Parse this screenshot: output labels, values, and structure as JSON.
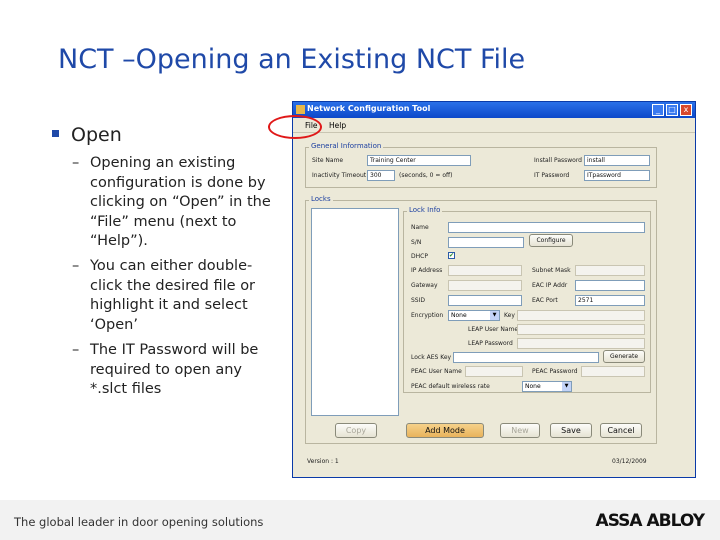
{
  "slide": {
    "title": "NCT –Opening an Existing NCT File",
    "bullet_main": "Open",
    "sub_bullets": [
      "Opening an existing configuration is done by clicking  on “Open” in the “File” menu (next to “Help”).",
      "You can either double-click the desired file or highlight it and select ‘Open’",
      "The IT Password will be required to open any *.slct files"
    ],
    "dash": "–"
  },
  "footer": {
    "tagline": "The global leader in door opening solutions",
    "logo": "ASSA ABLOY"
  },
  "app": {
    "window_title": "Network Configuration Tool",
    "menu": [
      "File",
      "Help"
    ],
    "window_buttons": [
      "_",
      "□",
      "x"
    ],
    "general": {
      "legend": "General Information",
      "site_name_label": "Site Name",
      "site_name_value": "Training Center",
      "inactivity_label": "Inactivity Timeout",
      "inactivity_value": "300",
      "inactivity_unit": "(seconds, 0 = off)",
      "install_pw_label": "Install Password",
      "install_pw_value": "install",
      "it_pw_label": "IT Password",
      "it_pw_value": "ITpassword"
    },
    "locks_legend": "Locks",
    "lockinfo": {
      "legend": "Lock Info",
      "name_label": "Name",
      "sn_label": "S/N",
      "configure_button": "Configure",
      "dhcp_label": "DHCP",
      "dhcp_checked": "✔",
      "ip_label": "IP Address",
      "subnet_label": "Subnet Mask",
      "gateway_label": "Gateway",
      "eac_ip_label": "EAC IP Addr",
      "ssid_label": "SSID",
      "eac_port_label": "EAC Port",
      "eac_port_value": "2571",
      "encryption_label": "Encryption",
      "encryption_value": "None",
      "key_label": "Key",
      "leap_user_label": "LEAP User Name",
      "leap_pw_label": "LEAP Password",
      "lock_aes_label": "Lock AES Key",
      "generate_button": "Generate",
      "peac_user_label": "PEAC User Name",
      "peac_pw_label": "PEAC Password",
      "peac_wl_label": "PEAC default wireless rate",
      "peac_wl_value": "None"
    },
    "buttons": {
      "copy": "Copy",
      "add_mode": "Add Mode",
      "new": "New",
      "save": "Save",
      "cancel": "Cancel"
    },
    "status": {
      "version": "Version : 1",
      "date": "03/12/2009"
    }
  }
}
